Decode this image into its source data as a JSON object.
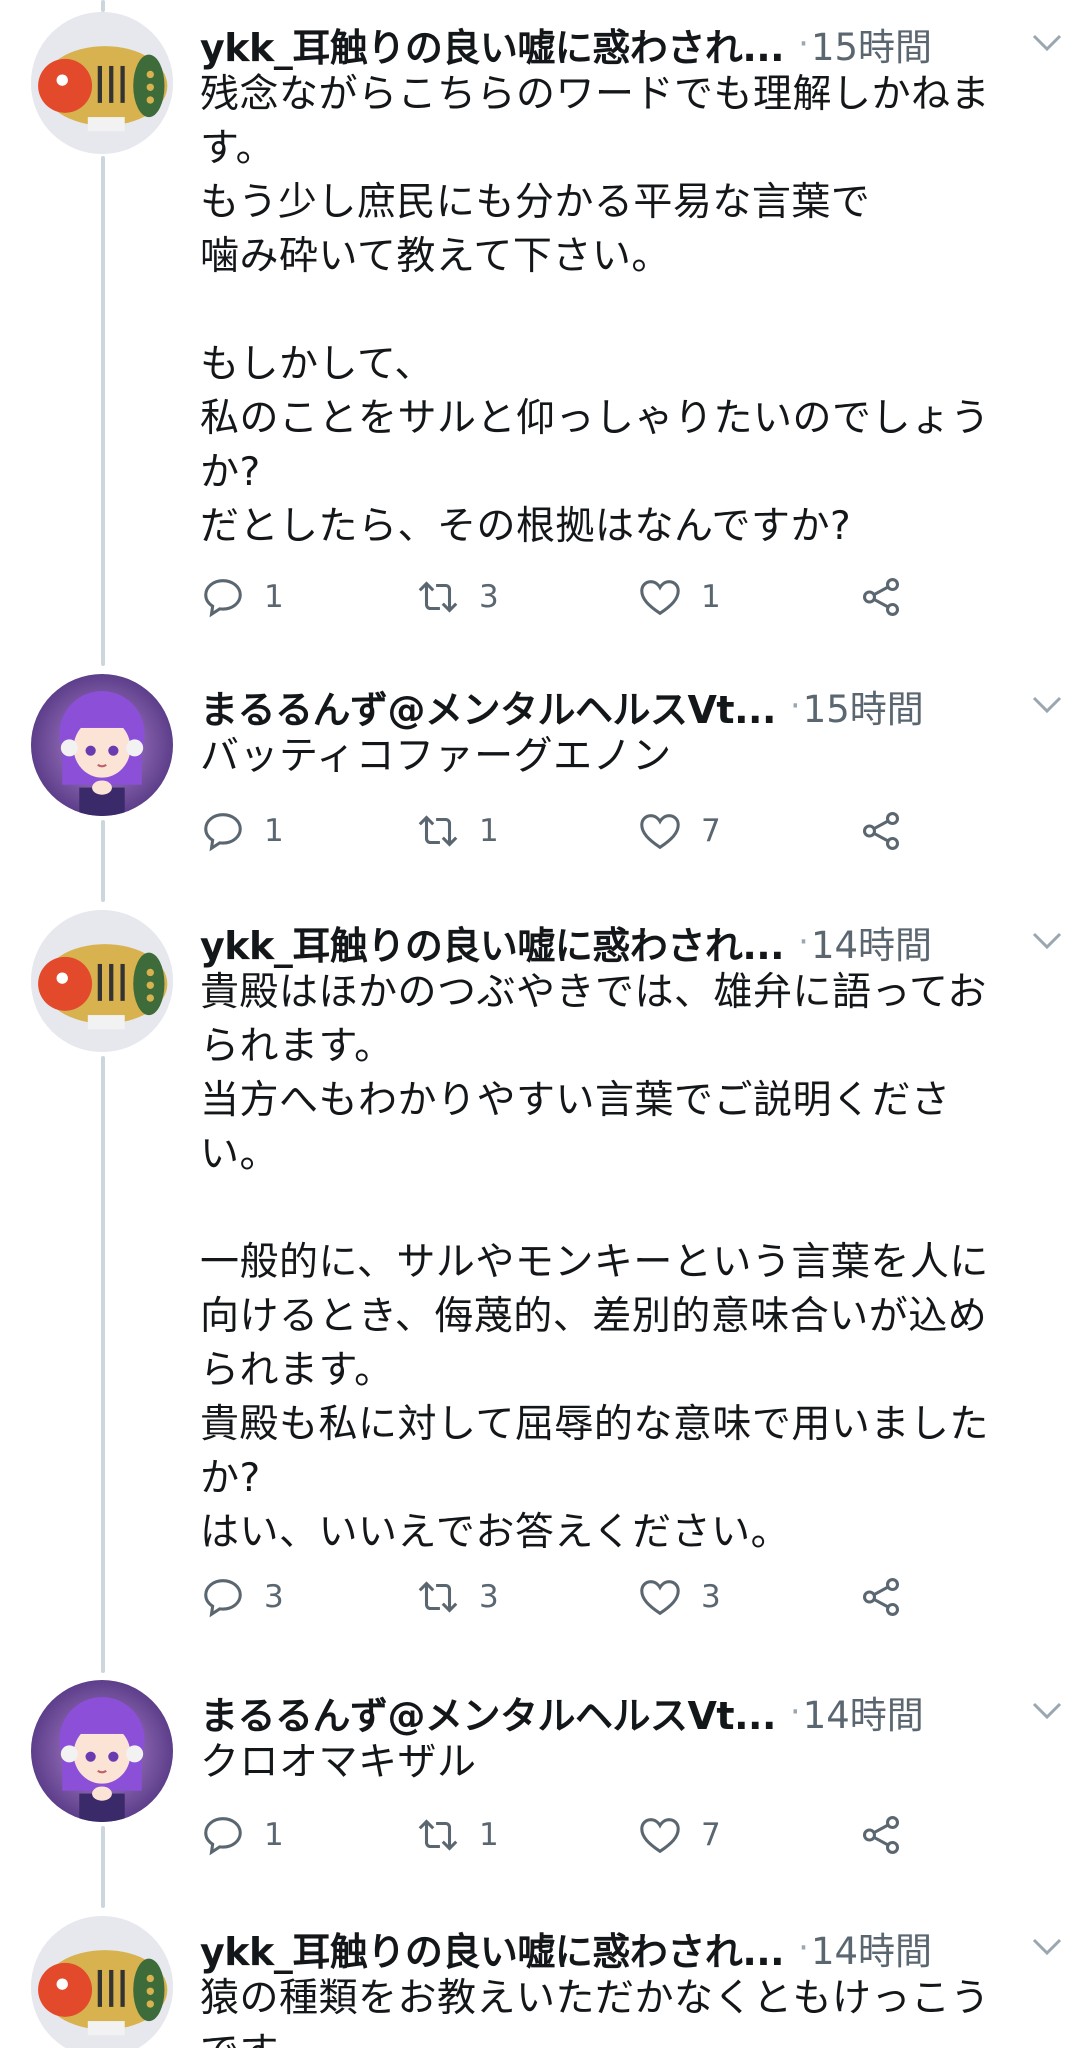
{
  "tweets": [
    {
      "name": "ykk_耳触りの良い嘘に惑わされ...",
      "time": "15時間",
      "text": "残念ながらこちらのワードでも理解しかねま\nす。\nもう少し庶民にも分かる平易な言葉で\n噛み砕いて教えて下さい。\n\nもしかして、\n私のことをサルと仰っしゃりたいのでしょう\nか?\nだとしたら、その根拠はなんですか?",
      "replies": "1",
      "retweets": "3",
      "likes": "1"
    },
    {
      "name": "まるるんず@メンタルヘルスVt...",
      "time": "15時間",
      "text": "バッティコファーグエノン",
      "replies": "1",
      "retweets": "1",
      "likes": "7"
    },
    {
      "name": "ykk_耳触りの良い嘘に惑わされ...",
      "time": "14時間",
      "text": "貴殿はほかのつぶやきでは、雄弁に語ってお\nられます。\n当方へもわかりやすい言葉でご説明くださ\nい。\n\n一般的に、サルやモンキーという言葉を人に\n向けるとき、侮蔑的、差別的意味合いが込め\nられます。\n貴殿も私に対して屈辱的な意味で用いました\nか?\nはい、いいえでお答えください。",
      "replies": "3",
      "retweets": "3",
      "likes": "3"
    },
    {
      "name": "まるるんず@メンタルヘルスVt...",
      "time": "14時間",
      "text": "クロオマキザル",
      "replies": "1",
      "retweets": "1",
      "likes": "7"
    },
    {
      "name": "ykk_耳触りの良い嘘に惑わされ...",
      "time": "14時間",
      "text": "猿の種類をお教えいただかなくともけっこう\nです。"
    }
  ],
  "separator": "·",
  "colors": {
    "text": "#14171a",
    "secondary": "#5b6770",
    "thread_line": "#ccd6dd",
    "avatar_hair": "#8b4fd8"
  },
  "icons": {
    "reply": "reply-icon",
    "retweet": "retweet-icon",
    "like": "heart-icon",
    "share": "share-icon",
    "menu": "chevron-down-icon"
  }
}
